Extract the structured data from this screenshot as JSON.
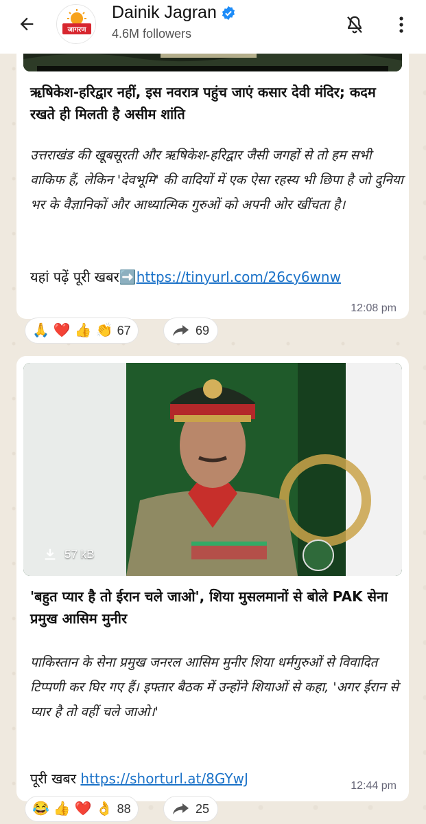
{
  "header": {
    "channel_name": "Dainik Jagran",
    "followers": "4.6M followers",
    "logo_text": "जागरण"
  },
  "posts": [
    {
      "headline": "ऋषिकेश-हरिद्वार नहीं, इस नवरात्र पहुंच जाएं कसार देवी मंदिर; कदम रखते ही मिलती है असीम शांति",
      "body": "उत्तराखंड की खूबसूरती और ऋषिकेश-हरिद्वार जैसी जगहों से तो हम सभी वाकिफ हैं, लेकिन 'देवभूमि' की वादियों में एक ऐसा रहस्य भी छिपा है जो दुनिया भर के वैज्ञानिकों और आध्यात्मिक गुरुओं को अपनी ओर खींचता है।",
      "link_prefix": "यहां पढ़ें पूरी खबर",
      "link_arrow": "➡️",
      "link_url": "https://tinyurl.com/26cy6wnw",
      "time": "12:08 pm",
      "reactions": [
        "🙏",
        "❤️",
        "👍",
        "👏"
      ],
      "reaction_count": "67",
      "forward_count": "69"
    },
    {
      "file_size": "57 kB",
      "headline": "'बहुत प्यार है तो ईरान चले जाओ', शिया मुसलमानों से बोले PAK सेना प्रमुख आसिम मुनीर",
      "body": "पाकिस्तान के सेना प्रमुख जनरल आसिम मुनीर शिया धर्मगुरुओं से विवादित टिप्पणी कर घिर गए हैं। इफ्तार बैठक में उन्होंने शियाओं से कहा, 'अगर ईरान से प्यार है तो वहीं चले जाओ।'",
      "link_prefix": "पूरी खबर",
      "link_url": "https://shorturl.at/8GYwJ",
      "time": "12:44 pm",
      "reactions": [
        "😂",
        "👍",
        "❤️",
        "👌"
      ],
      "reaction_count": "88",
      "forward_count": "25"
    }
  ],
  "colors": {
    "link": "#1b72c8",
    "verified": "#1d8cf8",
    "wallpaper": "#efe9df"
  },
  "icons": {
    "back": "arrow-left-icon",
    "verified": "verified-badge-icon",
    "mute": "bell-off-icon",
    "more": "more-vertical-icon",
    "download": "download-icon",
    "forward": "forward-icon"
  }
}
